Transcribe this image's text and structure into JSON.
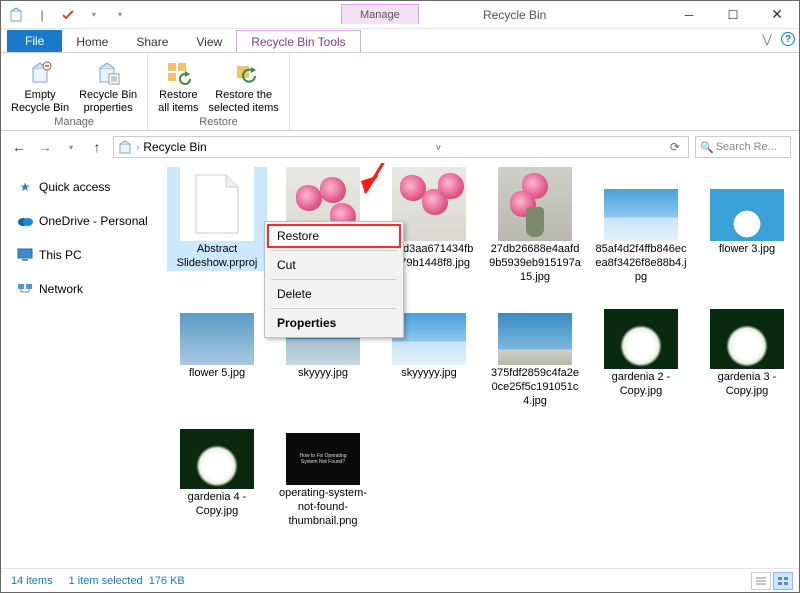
{
  "window": {
    "title": "Recycle Bin",
    "manage_tab": "Manage"
  },
  "tabs": {
    "file": "File",
    "home": "Home",
    "share": "Share",
    "view": "View",
    "tools": "Recycle Bin Tools"
  },
  "ribbon": {
    "empty": "Empty\nRecycle Bin",
    "props": "Recycle Bin\nproperties",
    "restore_all": "Restore\nall items",
    "restore_sel": "Restore the\nselected items",
    "grp_manage": "Manage",
    "grp_restore": "Restore"
  },
  "address": {
    "path": "Recycle Bin"
  },
  "search": {
    "placeholder": "Search Re..."
  },
  "nav": {
    "quick": "Quick access",
    "onedrive": "OneDrive - Personal",
    "thispc": "This PC",
    "network": "Network"
  },
  "items": [
    {
      "name": "Abstract Slideshow.prproj"
    },
    {
      "name": ""
    },
    {
      "name": "588d3aa671434fbe679b1448f8.jpg"
    },
    {
      "name": "27db26688e4aafd9b5939eb915197a15.jpg"
    },
    {
      "name": "85af4d2f4ffb846ecea8f3426f8e88b4.jpg"
    },
    {
      "name": "flower 3.jpg"
    },
    {
      "name": "flower 5.jpg"
    },
    {
      "name": "skyyyy.jpg"
    },
    {
      "name": "skyyyyy.jpg"
    },
    {
      "name": "375fdf2859c4fa2e0ce25f5c191051c4.jpg"
    },
    {
      "name": "gardenia 2 - Copy.jpg"
    },
    {
      "name": "gardenia 3 - Copy.jpg"
    },
    {
      "name": "gardenia 4 - Copy.jpg"
    },
    {
      "name": "operating-system-not-found-thumbnail.png"
    }
  ],
  "ctx": {
    "restore": "Restore",
    "cut": "Cut",
    "delete": "Delete",
    "props": "Properties"
  },
  "status": {
    "count": "14 items",
    "sel": "1 item selected",
    "size": "176 KB"
  }
}
